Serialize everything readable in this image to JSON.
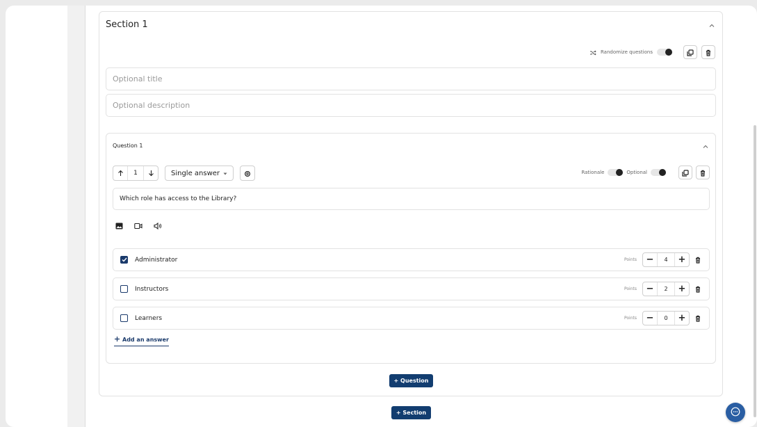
{
  "section": {
    "title": "Section 1",
    "randomize_label": "Randomize questions",
    "title_placeholder": "Optional title",
    "description_placeholder": "Optional description"
  },
  "question": {
    "title": "Question 1",
    "order_value": "1",
    "type_label": "Single answer",
    "rationale_label": "Rationale",
    "optional_label": "Optional",
    "prompt": "Which role has access to the Library?",
    "points_label": "Points",
    "answers": [
      {
        "label": "Administrator",
        "points": "4",
        "checked": true
      },
      {
        "label": "Instructors",
        "points": "2",
        "checked": false
      },
      {
        "label": "Learners",
        "points": "0",
        "checked": false
      }
    ],
    "add_answer_label": "Add an answer"
  },
  "buttons": {
    "add_question": "+ Question",
    "add_section": "+ Section"
  },
  "colors": {
    "primary": "#123d70",
    "chat": "#2a5ea3"
  },
  "icons": [
    "chevron-up-icon",
    "shuffle-icon",
    "copy-icon",
    "trash-icon",
    "arrow-up-icon",
    "arrow-down-icon",
    "caret-down-icon",
    "gear-icon",
    "image-icon",
    "video-icon",
    "audio-icon",
    "checkbox-icon",
    "minus-icon",
    "plus-icon",
    "chat-icon"
  ]
}
